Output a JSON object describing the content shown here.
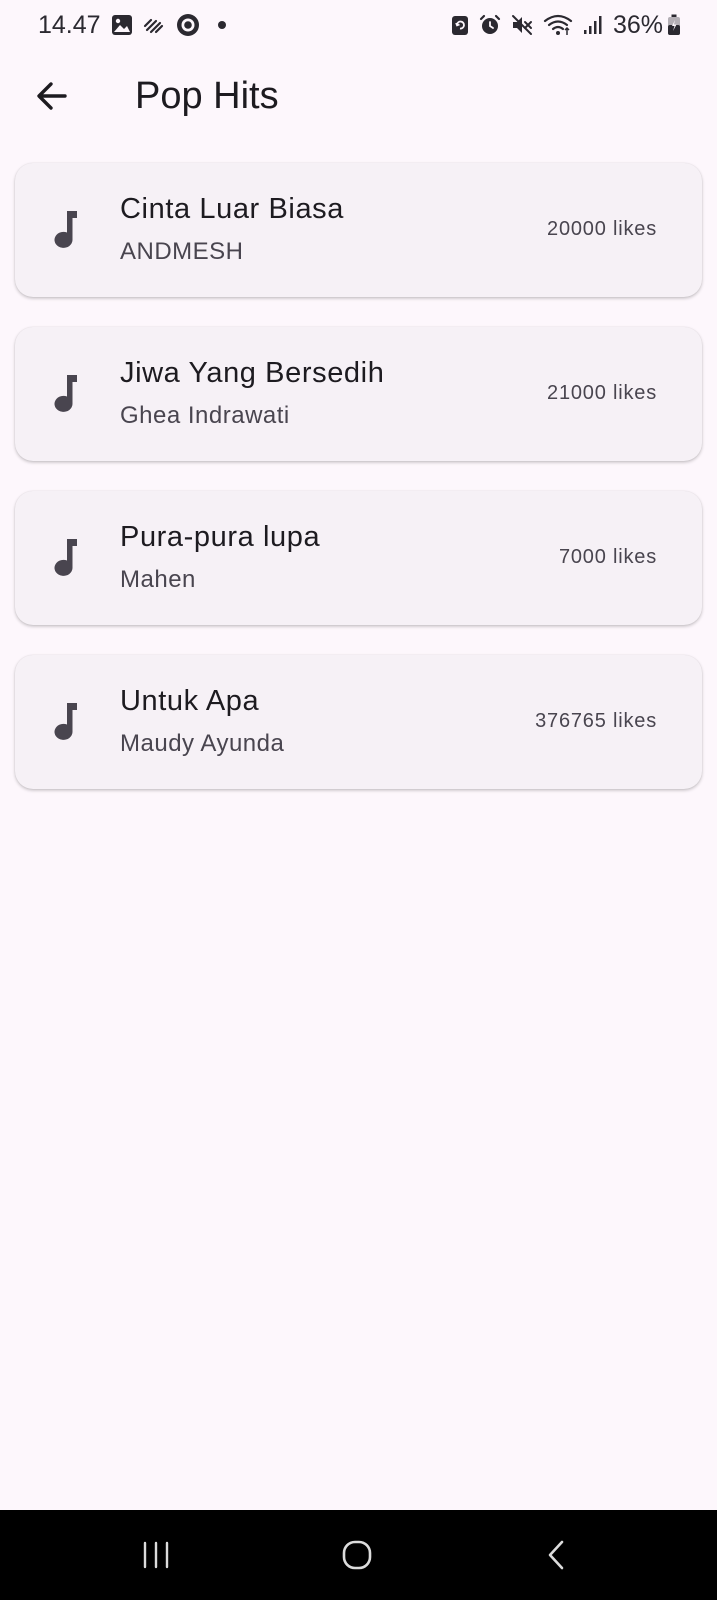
{
  "status_bar": {
    "time": "14.47",
    "battery": "36%",
    "left_icons": [
      "image-icon",
      "scribble-icon",
      "target-icon",
      "dot-icon"
    ],
    "right_icons": [
      "sync-icon",
      "alarm-icon",
      "mute-icon",
      "wifi-icon",
      "signal-icon",
      "battery-icon"
    ]
  },
  "app_bar": {
    "title": "Pop Hits",
    "back_icon": "arrow-left-icon"
  },
  "songs": [
    {
      "title": "Cinta Luar Biasa",
      "artist": "ANDMESH",
      "likes": "20000 likes",
      "icon": "music-note-icon"
    },
    {
      "title": "Jiwa Yang Bersedih",
      "artist": "Ghea Indrawati",
      "likes": "21000 likes",
      "icon": "music-note-icon"
    },
    {
      "title": "Pura-pura lupa",
      "artist": "Mahen",
      "likes": "7000 likes",
      "icon": "music-note-icon"
    },
    {
      "title": "Untuk Apa",
      "artist": "Maudy Ayunda",
      "likes": "376765 likes",
      "icon": "music-note-icon"
    }
  ],
  "nav_bar": {
    "buttons": [
      "recent-apps-icon",
      "home-icon",
      "back-icon"
    ]
  },
  "colors": {
    "background": "#fdf7fc",
    "card": "#f6f1f6",
    "text_primary": "#1d1b20",
    "text_secondary": "#49454f",
    "nav_bar": "#000000"
  }
}
